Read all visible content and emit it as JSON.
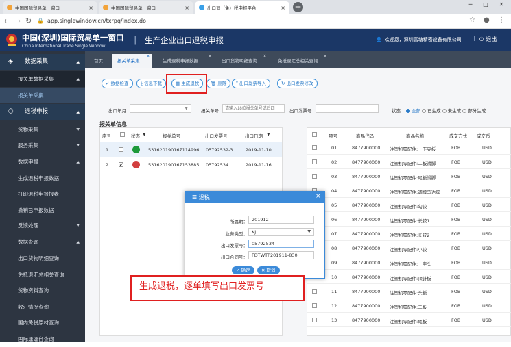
{
  "browser": {
    "tabs": [
      {
        "label": "中国国际贸易单一窗口",
        "close": "×"
      },
      {
        "label": "中国国际贸易单一窗口",
        "close": "×"
      },
      {
        "label": "出口退（免）税申报平台",
        "close": "×"
      }
    ],
    "url": "app.singlewindow.cn/txrpq/index.do",
    "new_tab": "+"
  },
  "header": {
    "title_cn": "中国(深圳)国际贸易单一窗口",
    "title_en": "China International Trade Single Window",
    "separator": "|",
    "subtitle": "生产企业出口退税申报",
    "welcome": "欢迎您，深圳富塘精密设备有限公司",
    "separator2": "|",
    "logout": "退出"
  },
  "sidebar": {
    "items": [
      {
        "label": "数据采集",
        "type": "main",
        "arrow": "▲",
        "icon": "stack-icon"
      },
      {
        "label": "报关单数据采集",
        "type": "sub",
        "arrow": "▲"
      },
      {
        "label": "报关单采集",
        "type": "selected"
      },
      {
        "label": "退税申报",
        "type": "main",
        "arrow": "▲",
        "icon": "cube-icon"
      },
      {
        "label": "货物采集",
        "type": "normal",
        "arrow": "▼"
      },
      {
        "label": "服务采集",
        "type": "normal",
        "arrow": "▼"
      },
      {
        "label": "数据申报",
        "type": "normal",
        "arrow": "▲"
      },
      {
        "label": "生成退税申报数据",
        "type": "leaf"
      },
      {
        "label": "打印退税申报报表",
        "type": "leaf"
      },
      {
        "label": "撤销已申报数据",
        "type": "leaf"
      },
      {
        "label": "反馈处理",
        "type": "normal",
        "arrow": "▼"
      },
      {
        "label": "数据查询",
        "type": "normal",
        "arrow": "▲"
      },
      {
        "label": "出口货物明细查询",
        "type": "leaf"
      },
      {
        "label": "免抵退汇总相关查询",
        "type": "leaf"
      },
      {
        "label": "货物资料查询",
        "type": "leaf"
      },
      {
        "label": "收汇情况查询",
        "type": "leaf"
      },
      {
        "label": "国内免税原材查询",
        "type": "leaf"
      },
      {
        "label": "国际運運台查询",
        "type": "leaf"
      }
    ]
  },
  "page_tabs": [
    {
      "label": "首页",
      "close": ""
    },
    {
      "label": "报关单采集",
      "close": "×"
    },
    {
      "label": "生成退税申报数据",
      "close": "×"
    },
    {
      "label": "出口货物明细查询",
      "close": "×"
    },
    {
      "label": "免抵退汇总相关查询",
      "close": "×"
    }
  ],
  "toolbar": {
    "buttons": [
      "数据检查",
      "信息下载",
      "生成退税",
      "删除",
      "出口发票导入",
      "出口发票修改"
    ]
  },
  "filters": {
    "export_month_label": "出口年月",
    "decl_no_label": "报关单号",
    "decl_no_placeholder": "请输入18位报关单号或后四",
    "invoice_label": "出口发票号",
    "status_label": "状态",
    "status_options": [
      "全部",
      "已生成",
      "未生成",
      "部分生成"
    ]
  },
  "left_table": {
    "title": "报关单信息",
    "headers": [
      "序号",
      "状态",
      "报关单号",
      "出口发票号",
      "出口日期"
    ],
    "sort_icon": "▼",
    "rows": [
      {
        "idx": "1",
        "checked": false,
        "status_color": "#1e9a3a",
        "decl_no": "531620190167114996",
        "invoice": "05792532-3",
        "date": "2019-11-10"
      },
      {
        "idx": "2",
        "checked": true,
        "status_color": "#d23f3f",
        "decl_no": "531620190167153885",
        "invoice": "05792534",
        "date": "2019-11-16"
      }
    ]
  },
  "right_table": {
    "headers": [
      "项号",
      "商品代码",
      "商品名称",
      "成交方式",
      "成交币"
    ],
    "rows": [
      {
        "no": "01",
        "code": "8477900000",
        "name": "注塑机零配件:上下夹板",
        "deal": "FOB",
        "cur": "USD"
      },
      {
        "no": "02",
        "code": "8477900000",
        "name": "注塑机零配件:二板滑脚",
        "deal": "FOB",
        "cur": "USD"
      },
      {
        "no": "03",
        "code": "8477900000",
        "name": "注塑机零配件:尾板滑脚",
        "deal": "FOB",
        "cur": "USD"
      },
      {
        "no": "04",
        "code": "8477900000",
        "name": "注塑机零配件:调模马达座",
        "deal": "FOB",
        "cur": "USD"
      },
      {
        "no": "05",
        "code": "8477900000",
        "name": "注塑机零配件:勾铰",
        "deal": "FOB",
        "cur": "USD"
      },
      {
        "no": "06",
        "code": "8477900000",
        "name": "注塑机零配件:长铰1",
        "deal": "FOB",
        "cur": "USD"
      },
      {
        "no": "07",
        "code": "8477900000",
        "name": "注塑机零配件:长铰2",
        "deal": "FOB",
        "cur": "USD"
      },
      {
        "no": "08",
        "code": "8477900000",
        "name": "注塑机零配件:小铰",
        "deal": "FOB",
        "cur": "USD"
      },
      {
        "no": "09",
        "code": "8477900000",
        "name": "注塑机零配件:十字头",
        "deal": "FOB",
        "cur": "USD"
      },
      {
        "no": "10",
        "code": "8477900000",
        "name": "注塑机零配件:顶针板",
        "deal": "FOB",
        "cur": "USD"
      },
      {
        "no": "11",
        "code": "8477900000",
        "name": "注塑机零配件:头板",
        "deal": "FOB",
        "cur": "USD"
      },
      {
        "no": "12",
        "code": "8477900000",
        "name": "注塑机零配件:二板",
        "deal": "FOB",
        "cur": "USD"
      },
      {
        "no": "13",
        "code": "8477900000",
        "name": "注塑机零配件:尾板",
        "deal": "FOB",
        "cur": "USD"
      }
    ]
  },
  "dialog": {
    "title": "退税",
    "close": "×",
    "fields": [
      {
        "label": "所属期：",
        "value": "201912"
      },
      {
        "label": "业务类型：",
        "value": "KJ"
      },
      {
        "label": "出口发票号：",
        "value": "05792534"
      },
      {
        "label": "出口合同号：",
        "value": "FDTWTP201911-830"
      }
    ],
    "ok": "确定",
    "cancel": "取消"
  },
  "annotation": "生成退税，逐单填写出口发票号"
}
